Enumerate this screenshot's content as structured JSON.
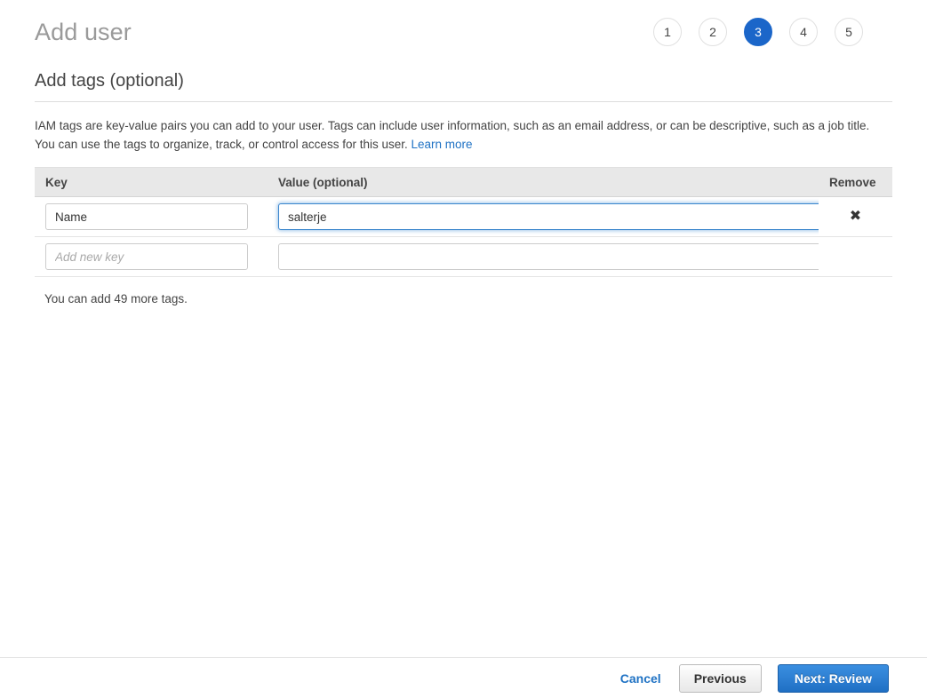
{
  "header": {
    "title": "Add user",
    "steps": [
      {
        "label": "1",
        "active": false
      },
      {
        "label": "2",
        "active": false
      },
      {
        "label": "3",
        "active": true
      },
      {
        "label": "4",
        "active": false
      },
      {
        "label": "5",
        "active": false
      }
    ]
  },
  "main": {
    "section_title": "Add tags (optional)",
    "description_text": "IAM tags are key-value pairs you can add to your user. Tags can include user information, such as an email address, or can be descriptive, such as a job title. You can use the tags to organize, track, or control access for this user. ",
    "learn_more_label": "Learn more",
    "table": {
      "headers": {
        "key": "Key",
        "value": "Value (optional)",
        "remove": "Remove"
      },
      "rows": [
        {
          "key_value": "Name",
          "key_placeholder": "",
          "value_value": "salterje",
          "value_placeholder": "",
          "value_focused": true,
          "remove_icon": "close-x-icon",
          "remove_glyph": "✖",
          "has_remove": true
        },
        {
          "key_value": "",
          "key_placeholder": "Add new key",
          "value_value": "",
          "value_placeholder": "",
          "value_focused": false,
          "remove_icon": "",
          "remove_glyph": "",
          "has_remove": false
        }
      ]
    },
    "more_tags_note": "You can add 49 more tags."
  },
  "footer": {
    "cancel_label": "Cancel",
    "previous_label": "Previous",
    "next_label": "Next: Review"
  },
  "colors": {
    "accent_blue": "#1b66c9",
    "link_blue": "#1f72c4",
    "title_gray": "#9a9a9a",
    "text_gray": "#444444",
    "table_header_bg": "#e8e8e8",
    "focus_border": "#3a86cd"
  }
}
